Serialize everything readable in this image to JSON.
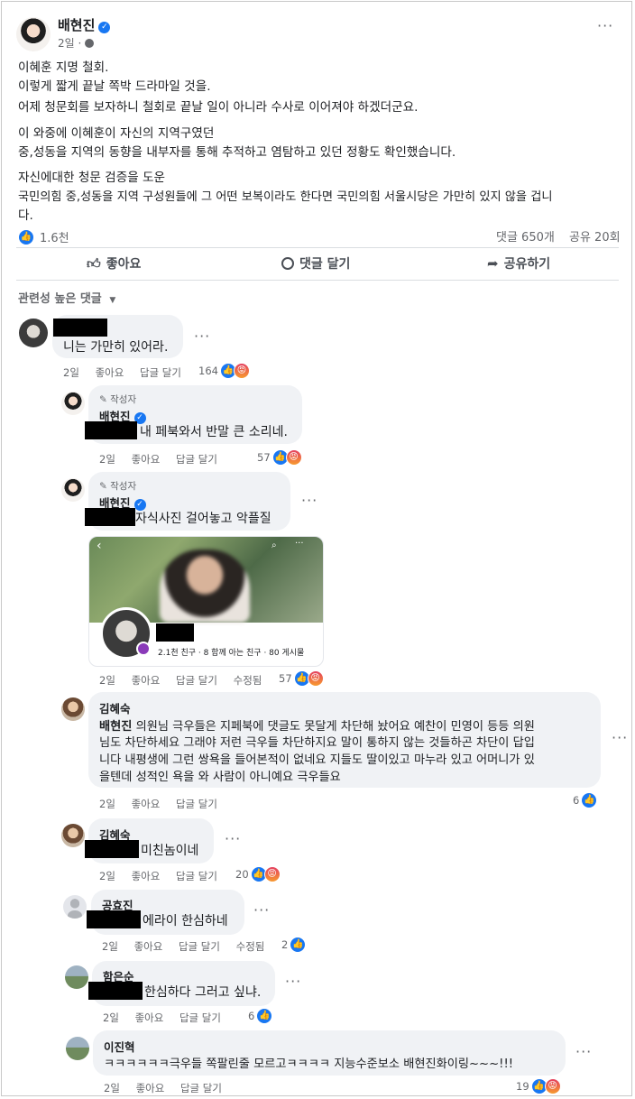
{
  "post": {
    "author": "배현진",
    "time": "2일 · ",
    "globe_icon": "globe-icon",
    "more": "···",
    "paragraphs": [
      "이혜훈 지명 철회.",
      "이렇게 짧게 끝날 쪽박 드라마일 것을.",
      "어제 청문회를 보자하니 철회로 끝날 일이 아니라 수사로 이어져야 하겠더군요.",
      "이 와중에 이혜훈이 자신의 지역구였던",
      "중,성동을 지역의 동향을 내부자를 통해 추적하고 염탐하고 있던 정황도 확인했습니다.",
      "자신에대한 청문 검증을 도운",
      "국민의힘 중,성동을 지역 구성원들에 그 어떤  보복이라도 한다면 국민의힘 서울시당은 가만히 있지 않을 겁니",
      "다."
    ],
    "reaction_count": "1.6천",
    "comments_count": "댓글 650개",
    "shares_count": "공유 20회",
    "actions": {
      "like": "좋아요",
      "comment": "댓글 달기",
      "share": "공유하기"
    },
    "sort_label": "관련성 높은 댓글"
  },
  "labels": {
    "like": "좋아요",
    "reply": "답글 달기",
    "edited": "수정됨",
    "author_badge": "작성자",
    "more": "···"
  },
  "comments": [
    {
      "time": "2일",
      "text": "니는 가만히 있어라.",
      "reactions": "164"
    },
    {
      "name": "배현진",
      "time": "2일",
      "text": "내 페북와서 반말 큰 소리네.",
      "reactions": "57"
    },
    {
      "name": "배현진",
      "time": "2일",
      "text": "자식사진 걸어놓고 악플질",
      "reactions": "57",
      "profile_card": {
        "stats": "2.1천 친구 · 8 함께 아는 친구 · 80 게시물"
      }
    },
    {
      "name": "김혜숙",
      "time": "2일",
      "reactions": "6",
      "mention": "배현진",
      "lines": [
        " 의원님 극우들은 지페북에 댓글도 못달게 차단해 놨어요 예찬이 민영이 등등 의원",
        "님도 차단하세요 그래야 저런 극우들 차단하지요 말이 통하지 않는 것들하곤 차단이 답입",
        "니다 내평생에 그런 쌍욕을 들어본적이 없네요 지들도 딸이있고 마누라 있고 어머니가 있",
        "을텐데 성적인 욕을 와 사람이 아니예요 극우들요"
      ]
    },
    {
      "name": "김혜숙",
      "time": "2일",
      "text": "미친놈이네",
      "reactions": "20"
    },
    {
      "name": "공효진",
      "time": "2일",
      "text": "에라이 한심하네",
      "reactions": "2"
    },
    {
      "name": "함은순",
      "time": "2일",
      "text": "한심하다 그러고 싶냐.",
      "reactions": "6"
    },
    {
      "name": "이진혁",
      "time": "2일",
      "text": "ㅋㅋㅋㅋㅋㅋ극우들 쪽팔린줄 모르고ㅋㅋㅋㅋ 지능수준보소 배현진화이링~~~!!!",
      "reactions": "19"
    }
  ]
}
